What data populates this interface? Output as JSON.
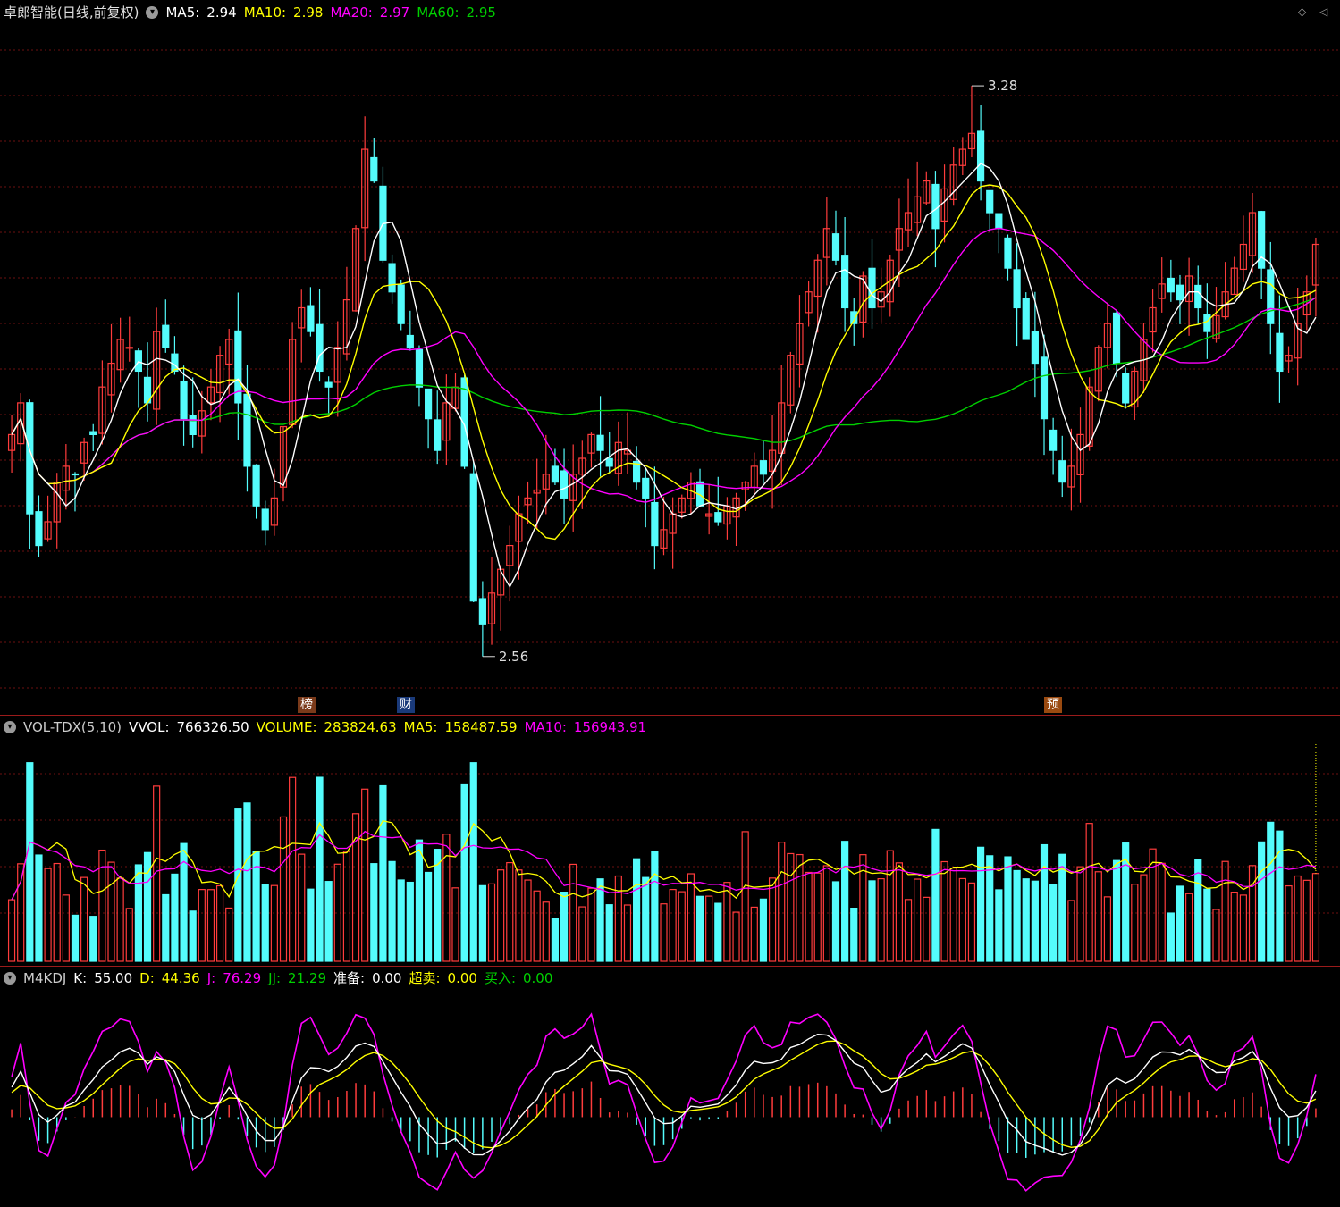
{
  "main_header": {
    "title": "卓郎智能(日线,前复权)",
    "ma5_label": "MA5:",
    "ma5_val": "2.94",
    "ma10_label": "MA10:",
    "ma10_val": "2.98",
    "ma20_label": "MA20:",
    "ma20_val": "2.97",
    "ma60_label": "MA60:",
    "ma60_val": "2.95"
  },
  "vol_header": {
    "name": "VOL-TDX(5,10)",
    "vvol_label": "VVOL:",
    "vvol_val": "766326.50",
    "volume_label": "VOLUME:",
    "volume_val": "283824.63",
    "ma5_label": "MA5:",
    "ma5_val": "158487.59",
    "ma10_label": "MA10:",
    "ma10_val": "156943.91"
  },
  "kdj_header": {
    "name": "M4KDJ",
    "k_label": "K:",
    "k_val": "55.00",
    "d_label": "D:",
    "d_val": "44.36",
    "j_label": "J:",
    "j_val": "76.29",
    "jj_label": "JJ:",
    "jj_val": "21.29",
    "prep_label": "准备:",
    "prep_val": "0.00",
    "oversold_label": "超卖:",
    "oversold_val": "0.00",
    "buy_label": "买入:",
    "buy_val": "0.00"
  },
  "markers": {
    "high_label": "3.28",
    "low_label": "2.56",
    "tag_bang": "榜",
    "tag_cai": "财",
    "tag_yu": "预"
  },
  "colors": {
    "up": "#ff3c3c",
    "down": "#54fcfc",
    "ma5": "#ffffff",
    "ma10": "#ffff00",
    "ma20": "#ff00ff",
    "ma60": "#00d000",
    "grid": "#6b1010",
    "separator": "#9b1b1b"
  },
  "chart_data": [
    {
      "type": "candlestick",
      "title": "卓郎智能(日线,前复权)",
      "price_range": [
        2.5,
        3.35
      ],
      "annotated_high": 3.28,
      "annotated_low": 2.56,
      "close": [
        2.84,
        2.88,
        2.74,
        2.7,
        2.73,
        2.78,
        2.8,
        2.79,
        2.83,
        2.84,
        2.9,
        2.93,
        2.96,
        2.95,
        2.92,
        2.88,
        2.97,
        2.95,
        2.92,
        2.86,
        2.84,
        2.87,
        2.9,
        2.94,
        2.96,
        2.88,
        2.8,
        2.75,
        2.72,
        2.76,
        2.85,
        2.96,
        3.0,
        2.97,
        2.92,
        2.9,
        2.95,
        3.01,
        3.1,
        3.2,
        3.16,
        3.06,
        3.02,
        2.98,
        2.95,
        2.9,
        2.86,
        2.82,
        2.88,
        2.9,
        2.8,
        2.63,
        2.6,
        2.64,
        2.67,
        2.7,
        2.74,
        2.76,
        2.77,
        2.79,
        2.78,
        2.76,
        2.79,
        2.81,
        2.84,
        2.82,
        2.8,
        2.83,
        2.82,
        2.78,
        2.76,
        2.7,
        2.72,
        2.74,
        2.76,
        2.78,
        2.75,
        2.74,
        2.73,
        2.75,
        2.76,
        2.78,
        2.8,
        2.79,
        2.82,
        2.88,
        2.94,
        2.98,
        3.02,
        3.06,
        3.1,
        3.06,
        3.0,
        2.98,
        3.04,
        3.0,
        3.02,
        3.06,
        3.1,
        3.12,
        3.14,
        3.16,
        3.1,
        3.15,
        3.18,
        3.2,
        3.22,
        3.16,
        3.12,
        3.1,
        3.05,
        3.0,
        2.96,
        2.93,
        2.86,
        2.82,
        2.78,
        2.8,
        2.84,
        2.9,
        2.95,
        2.98,
        2.93,
        2.88,
        2.92,
        2.96,
        3.0,
        3.03,
        3.02,
        3.01,
        3.04,
        3.0,
        2.97,
        2.99,
        3.02,
        3.05,
        3.08,
        3.12,
        3.05,
        2.98,
        2.92,
        2.94,
        2.98,
        3.02,
        3.08
      ],
      "ma_latest": {
        "MA5": 2.94,
        "MA10": 2.98,
        "MA20": 2.97,
        "MA60": 2.95
      }
    },
    {
      "type": "bar",
      "title": "VOL-TDX(5,10)",
      "latest": {
        "VVOL": 766326.5,
        "VOLUME": 283824.63,
        "MA5": 158487.59,
        "MA10": 156943.91
      }
    },
    {
      "type": "line",
      "title": "M4KDJ",
      "latest": {
        "K": 55.0,
        "D": 44.36,
        "J": 76.29,
        "JJ": 21.29,
        "准备": 0.0,
        "超卖": 0.0,
        "买入": 0.0
      }
    }
  ]
}
